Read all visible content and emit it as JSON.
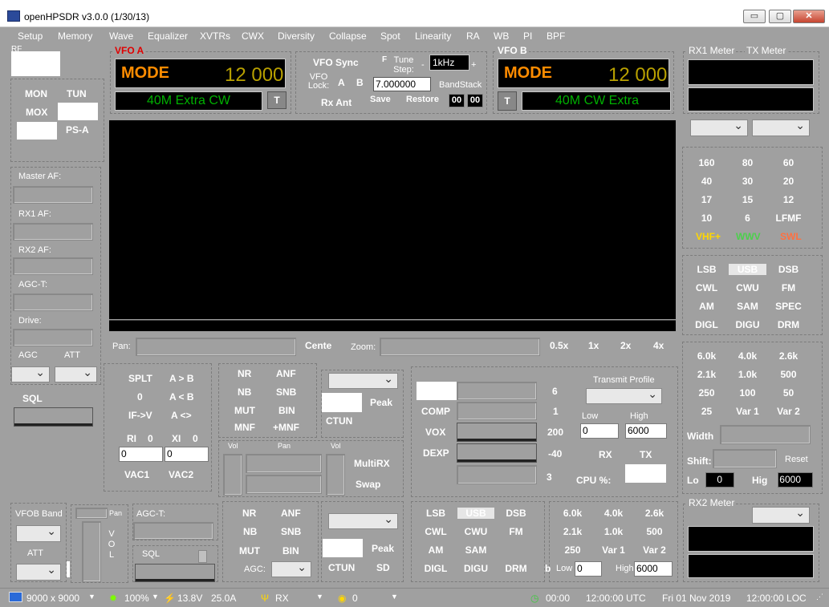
{
  "window": {
    "title": "openHPSDR v3.0.0 (1/30/13)",
    "min": "▭",
    "max": "▢",
    "close": "✕"
  },
  "menu": [
    "Setup",
    "Memory",
    "Wave",
    "Equalizer",
    "XVTRs",
    "CWX",
    "Diversity",
    "Collapse",
    "Spot",
    "Linearity",
    "RA",
    "WB",
    "PI",
    "BPF"
  ],
  "left": {
    "rf_label": "RF",
    "mon": "MON",
    "tun": "TUN",
    "mox": "MOX",
    "psa": "PS-A",
    "master_af": "Master AF:",
    "rx1_af": "RX1 AF:",
    "rx2_af": "RX2 AF:",
    "agc_t": "AGC-T:",
    "drive": "Drive:",
    "agc": "AGC",
    "att": "ATT",
    "sql": "SQL"
  },
  "vfoa": {
    "label": "VFO A",
    "mode": "MODE",
    "freq": "12 000",
    "band": "40M Extra CW",
    "t": "T"
  },
  "vfob": {
    "label": "VFO B",
    "mode": "MODE",
    "freq": "12 000",
    "band": "40M CW Extra",
    "t": "T"
  },
  "center": {
    "vfo_sync": "VFO Sync",
    "f": "F",
    "tune_step": "Tune Step:",
    "minus": "-",
    "plus": "+",
    "step": "1kHz",
    "vfo_lock": "VFO Lock:",
    "a": "A",
    "b": "B",
    "freq_value": "7.000000",
    "bandstack": "BandStack",
    "rx_ant": "Rx Ant",
    "save": "Save",
    "restore": "Restore",
    "bs1": "00",
    "bs2": "00"
  },
  "meters": {
    "rx1": "RX1 Meter",
    "tx": "TX Meter",
    "rx2": "RX2 Meter"
  },
  "bands": [
    "160",
    "80",
    "60",
    "40",
    "30",
    "20",
    "17",
    "15",
    "12",
    "10",
    "6",
    "LFMF"
  ],
  "bands_special": [
    {
      "l": "VHF+",
      "c": "#ffd700"
    },
    {
      "l": "WWV",
      "c": "#4cd04c"
    },
    {
      "l": "SWL",
      "c": "#ff7040"
    }
  ],
  "modes": [
    "LSB",
    "USB",
    "DSB",
    "CWL",
    "CWU",
    "FM",
    "AM",
    "SAM",
    "SPEC",
    "DIGL",
    "DIGU",
    "DRM"
  ],
  "filters": [
    "6.0k",
    "4.0k",
    "2.6k",
    "2.1k",
    "1.0k",
    "500",
    "250",
    "100",
    "50",
    "25",
    "Var 1",
    "Var 2"
  ],
  "filter_ctrl": {
    "width": "Width",
    "shift": "Shift:",
    "reset": "Reset",
    "lo": "Lo",
    "lo_val": "0",
    "hig": "Hig",
    "hig_val": "6000"
  },
  "pan": {
    "pan": "Pan:",
    "center": "Cente",
    "zoom": "Zoom:",
    "z1": "0.5x",
    "z2": "1x",
    "z3": "2x",
    "z4": "4x"
  },
  "vfo_ctrl": {
    "splt": "SPLT",
    "atob": "A > B",
    "zero": "0",
    "btoa": "A < B",
    "ifv": "IF->V",
    "aswap": "A <>",
    "ri": "RI",
    "ri_v": "0",
    "xi": "XI",
    "xi_v": "0",
    "ri_in": "0",
    "xi_in": "0",
    "vac1": "VAC1",
    "vac2": "VAC2"
  },
  "dsp1": {
    "nr": "NR",
    "anf": "ANF",
    "nb": "NB",
    "snb": "SNB",
    "mut": "MUT",
    "bin": "BIN",
    "mnf": "MNF",
    "pmnf": "+MNF"
  },
  "peak1": {
    "peak": "Peak",
    "ctun": "CTUN"
  },
  "mix": {
    "vol": "Vol",
    "pan": "Pan",
    "vol2": "Vol",
    "multirx": "MultiRX",
    "swap": "Swap"
  },
  "tx": {
    "comp": "COMP",
    "vox": "VOX",
    "dexp": "DEXP",
    "n6": "6",
    "n1": "1",
    "n200": "200",
    "nm40": "-40",
    "n3": "3",
    "profile": "Transmit Profile",
    "low": "Low",
    "high": "High",
    "low_v": "0",
    "high_v": "6000",
    "rx": "RX",
    "tx": "TX",
    "cpu": "CPU %:"
  },
  "rx2": {
    "vfob_band": "VFOB Band",
    "att": "ATT",
    "pan": "Pan",
    "vol": "V O L",
    "agc_t": "AGC-T:",
    "sql": "SQL",
    "nr": "NR",
    "anf": "ANF",
    "nb": "NB",
    "snb": "SNB",
    "mut": "MUT",
    "bin": "BIN",
    "agc": "AGC:",
    "peak": "Peak",
    "ctun": "CTUN",
    "sd": "SD"
  },
  "modes2": [
    "LSB",
    "USB",
    "DSB",
    "CWL",
    "CWU",
    "FM",
    "AM",
    "SAM",
    "",
    "DIGL",
    "DIGU",
    "DRM"
  ],
  "filters2": [
    "6.0k",
    "4.0k",
    "2.6k",
    "2.1k",
    "1.0k",
    "500",
    "250",
    "Var 1",
    "Var 2"
  ],
  "filter2_ctrl": {
    "b": "b",
    "low": "Low",
    "low_v": "0",
    "high": "High",
    "high_v": "6000"
  },
  "status": {
    "res": "9000 x 9000",
    "pct": "100%",
    "volt": "13.8V",
    "amp": "25.0A",
    "rx": "RX",
    "rxn": "0",
    "time1": "00:00",
    "utc": "12:00:00 UTC",
    "date": "Fri 01 Nov 2019",
    "loc": "12:00:00 LOC"
  }
}
